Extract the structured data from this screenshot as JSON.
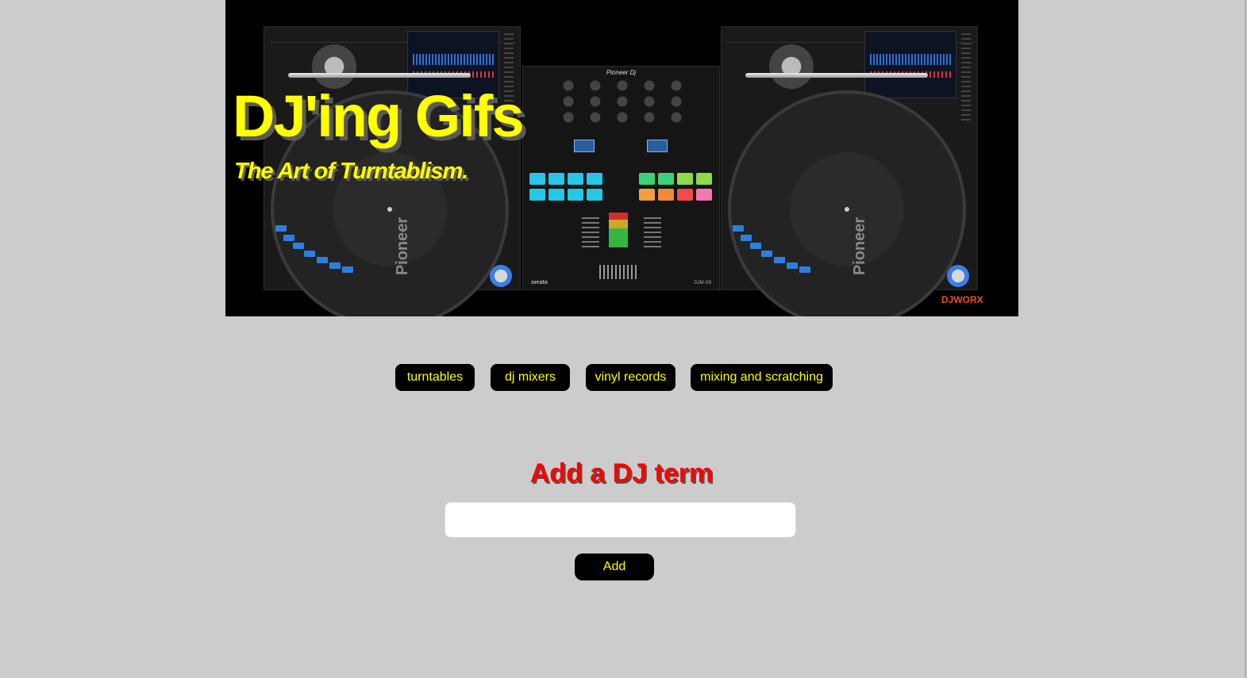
{
  "hero": {
    "title": "DJ'ing Gifs",
    "subtitle": "The Art of Turntablism.",
    "image_labels": {
      "deck_brand": "Pioneer",
      "mixer_brand": "Pioneer Dj",
      "mixer_model": "DJM-S9",
      "mixer_software": "serato",
      "corner_logo": "DJWORX"
    }
  },
  "nav": {
    "buttons": [
      {
        "label": "turntables"
      },
      {
        "label": "dj mixers"
      },
      {
        "label": "vinyl records"
      },
      {
        "label": "mixing and scratching"
      }
    ]
  },
  "form": {
    "heading": "Add a DJ term",
    "input_value": "",
    "input_placeholder": "",
    "submit_label": "Add"
  },
  "colors": {
    "page_background": "#cccccc",
    "title_yellow": "#ffff00",
    "heading_red": "#ff0000",
    "button_background": "#000000"
  }
}
